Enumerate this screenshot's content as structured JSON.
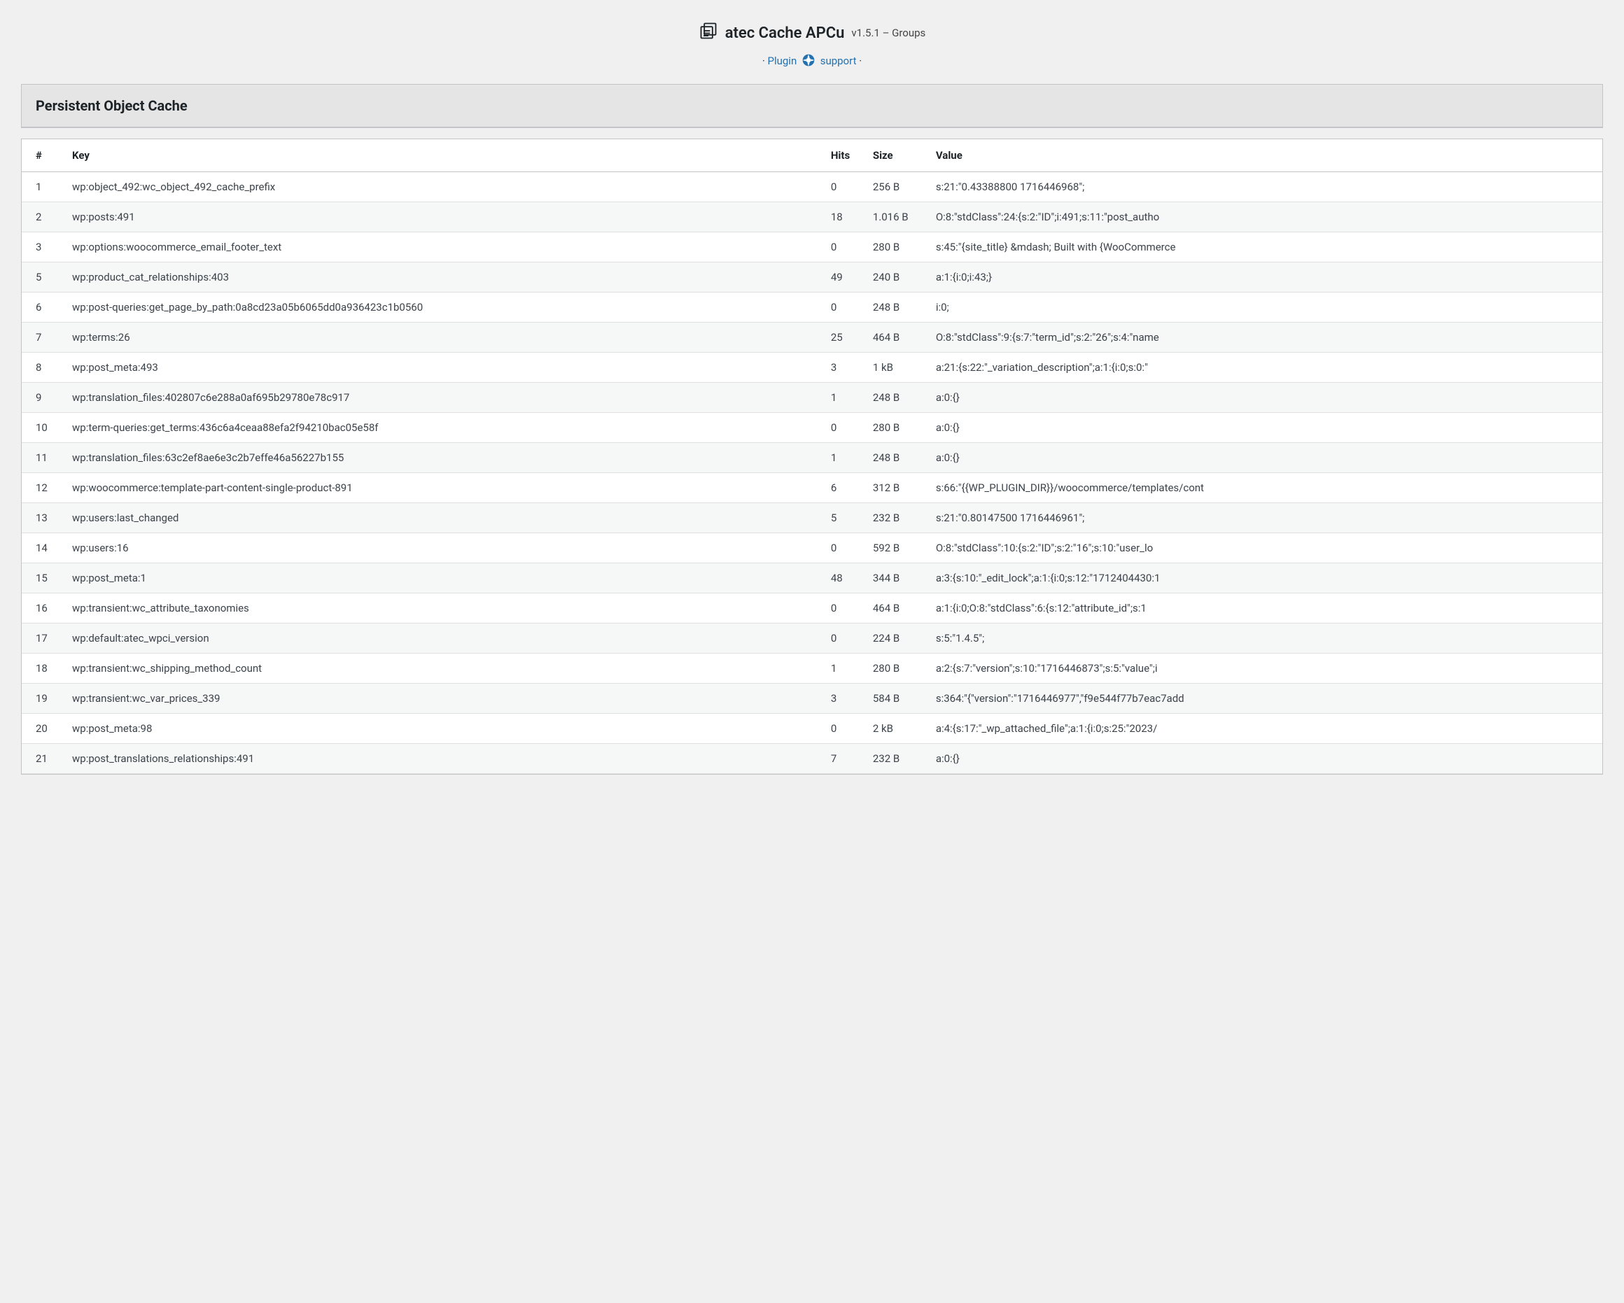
{
  "header": {
    "title": "atec Cache APCu",
    "version": "v1.5.1 – Groups",
    "link_plugin": "Plugin",
    "link_support": "support",
    "sep": "·"
  },
  "panel": {
    "title": "Persistent Object Cache"
  },
  "table": {
    "headers": {
      "num": "#",
      "key": "Key",
      "hits": "Hits",
      "size": "Size",
      "value": "Value"
    },
    "rows": [
      {
        "n": "1",
        "key": "wp:object_492:wc_object_492_cache_prefix",
        "hits": "0",
        "size": "256 B",
        "value": "s:21:\"0.43388800 1716446968\";"
      },
      {
        "n": "2",
        "key": "wp:posts:491",
        "hits": "18",
        "size": "1.016 B",
        "value": "O:8:\"stdClass\":24:{s:2:\"ID\";i:491;s:11:\"post_autho"
      },
      {
        "n": "3",
        "key": "wp:options:woocommerce_email_footer_text",
        "hits": "0",
        "size": "280 B",
        "value": "s:45:\"{site_title} &mdash; Built with {WooCommerce"
      },
      {
        "n": "5",
        "key": "wp:product_cat_relationships:403",
        "hits": "49",
        "size": "240 B",
        "value": "a:1:{i:0;i:43;}"
      },
      {
        "n": "6",
        "key": "wp:post-queries:get_page_by_path:0a8cd23a05b6065dd0a936423c1b0560",
        "hits": "0",
        "size": "248 B",
        "value": "i:0;"
      },
      {
        "n": "7",
        "key": "wp:terms:26",
        "hits": "25",
        "size": "464 B",
        "value": "O:8:\"stdClass\":9:{s:7:\"term_id\";s:2:\"26\";s:4:\"name"
      },
      {
        "n": "8",
        "key": "wp:post_meta:493",
        "hits": "3",
        "size": "1 kB",
        "value": "a:21:{s:22:\"_variation_description\";a:1:{i:0;s:0:\""
      },
      {
        "n": "9",
        "key": "wp:translation_files:402807c6e288a0af695b29780e78c917",
        "hits": "1",
        "size": "248 B",
        "value": "a:0:{}"
      },
      {
        "n": "10",
        "key": "wp:term-queries:get_terms:436c6a4ceaa88efa2f94210bac05e58f",
        "hits": "0",
        "size": "280 B",
        "value": "a:0:{}"
      },
      {
        "n": "11",
        "key": "wp:translation_files:63c2ef8ae6e3c2b7effe46a56227b155",
        "hits": "1",
        "size": "248 B",
        "value": "a:0:{}"
      },
      {
        "n": "12",
        "key": "wp:woocommerce:template-part-content-single-product-891",
        "hits": "6",
        "size": "312 B",
        "value": "s:66:\"{{WP_PLUGIN_DIR}}/woocommerce/templates/cont"
      },
      {
        "n": "13",
        "key": "wp:users:last_changed",
        "hits": "5",
        "size": "232 B",
        "value": "s:21:\"0.80147500 1716446961\";"
      },
      {
        "n": "14",
        "key": "wp:users:16",
        "hits": "0",
        "size": "592 B",
        "value": "O:8:\"stdClass\":10:{s:2:\"ID\";s:2:\"16\";s:10:\"user_lo"
      },
      {
        "n": "15",
        "key": "wp:post_meta:1",
        "hits": "48",
        "size": "344 B",
        "value": "a:3:{s:10:\"_edit_lock\";a:1:{i:0;s:12:\"1712404430:1"
      },
      {
        "n": "16",
        "key": "wp:transient:wc_attribute_taxonomies",
        "hits": "0",
        "size": "464 B",
        "value": "a:1:{i:0;O:8:\"stdClass\":6:{s:12:\"attribute_id\";s:1"
      },
      {
        "n": "17",
        "key": "wp:default:atec_wpci_version",
        "hits": "0",
        "size": "224 B",
        "value": "s:5:\"1.4.5\";"
      },
      {
        "n": "18",
        "key": "wp:transient:wc_shipping_method_count",
        "hits": "1",
        "size": "280 B",
        "value": "a:2:{s:7:\"version\";s:10:\"1716446873\";s:5:\"value\";i"
      },
      {
        "n": "19",
        "key": "wp:transient:wc_var_prices_339",
        "hits": "3",
        "size": "584 B",
        "value": "s:364:\"{\"version\":\"1716446977\",\"f9e544f77b7eac7add"
      },
      {
        "n": "20",
        "key": "wp:post_meta:98",
        "hits": "0",
        "size": "2 kB",
        "value": "a:4:{s:17:\"_wp_attached_file\";a:1:{i:0;s:25:\"2023/"
      },
      {
        "n": "21",
        "key": "wp:post_translations_relationships:491",
        "hits": "7",
        "size": "232 B",
        "value": "a:0:{}"
      }
    ]
  }
}
